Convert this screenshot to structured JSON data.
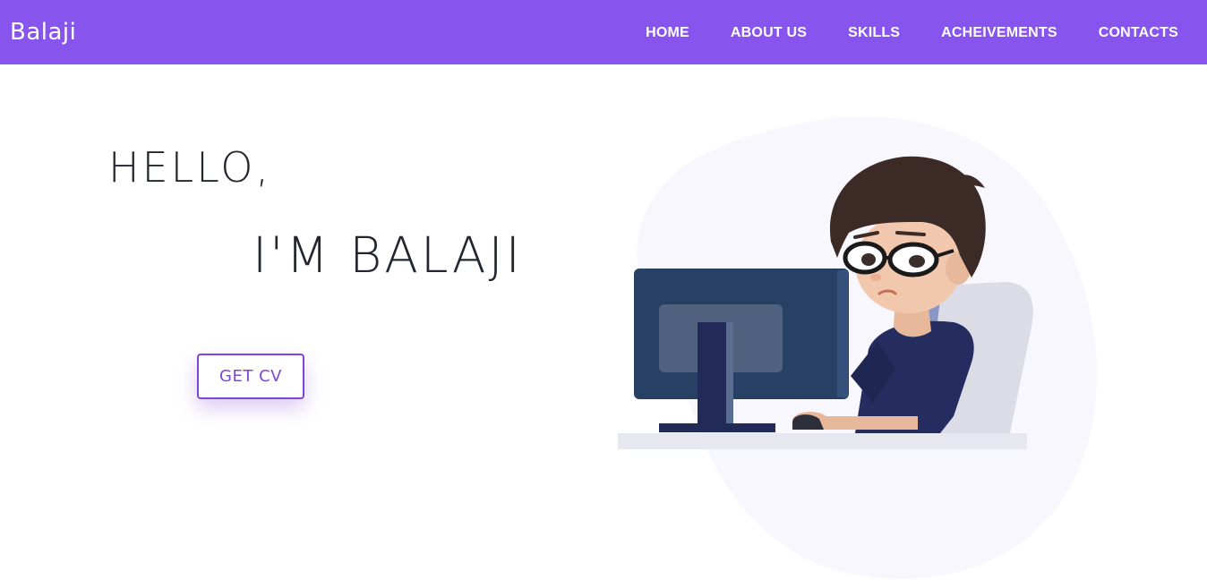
{
  "brand": {
    "name": "Balaji"
  },
  "nav": {
    "items": [
      {
        "label": "HOME"
      },
      {
        "label": "ABOUT US"
      },
      {
        "label": "SKILLS"
      },
      {
        "label": "ACHEIVEMENTS"
      },
      {
        "label": "CONTACTS"
      }
    ]
  },
  "hero": {
    "greeting": "HELLO,",
    "name": "I'M BALAJI",
    "cv_button": "GET CV"
  },
  "colors": {
    "nav_bg": "#8854ee",
    "accent": "#7e46d6",
    "text_dark": "#23262e",
    "blob": "#f7f7fd"
  },
  "icons": {
    "illustration": "developer-at-computer-illustration"
  }
}
